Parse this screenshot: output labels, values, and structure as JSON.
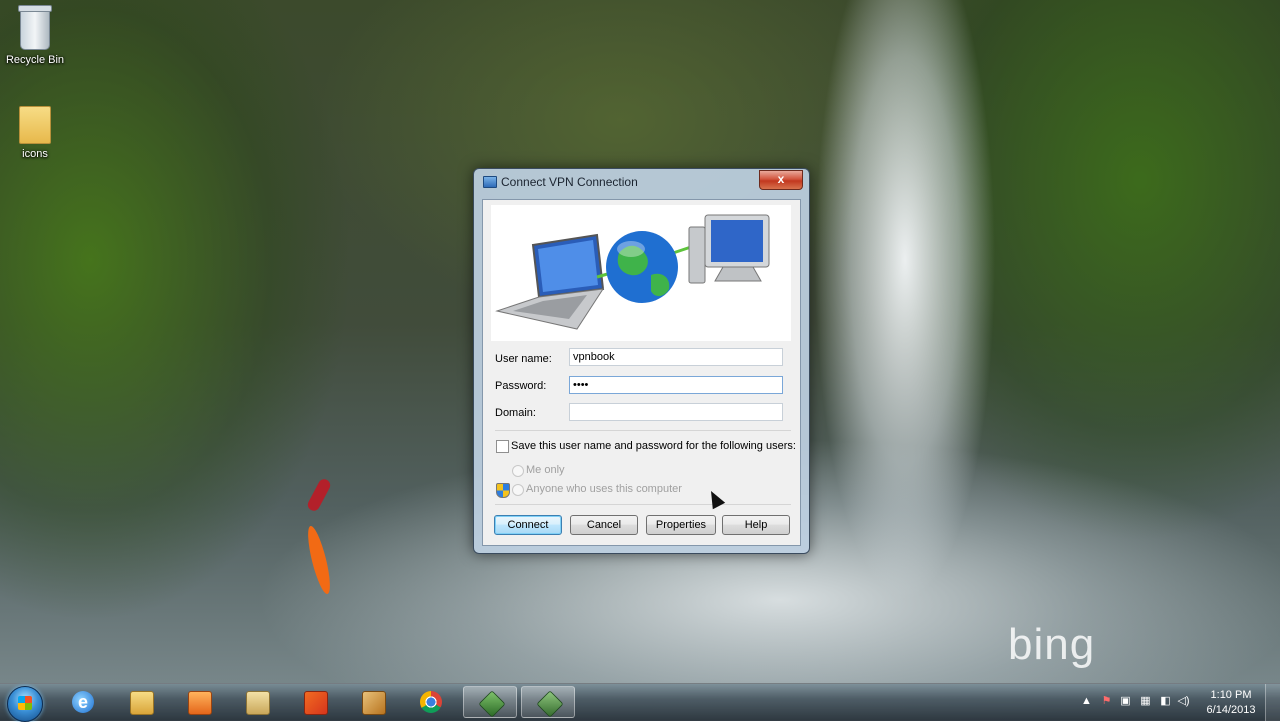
{
  "desktop": {
    "icons": [
      {
        "label": "Recycle Bin",
        "icon": "recycle-bin-icon"
      },
      {
        "label": "icons",
        "icon": "folder-icon"
      }
    ],
    "wallpaper_brand": "bing"
  },
  "dialog": {
    "title": "Connect VPN Connection",
    "close_label": "x",
    "username_label": "User name:",
    "username_value": "vpnbook",
    "password_label": "Password:",
    "password_value": "••••",
    "domain_label": "Domain:",
    "domain_value": "",
    "save_checkbox_label": "Save this user name and password for the following users:",
    "save_checked": false,
    "me_only_label": "Me only",
    "anyone_label": "Anyone who uses this computer",
    "buttons": {
      "connect": "Connect",
      "cancel": "Cancel",
      "properties": "Properties",
      "help": "Help"
    }
  },
  "taskbar": {
    "pinned": [
      {
        "name": "internet-explorer",
        "icon": "ie-icon"
      },
      {
        "name": "windows-explorer",
        "icon": "folder-icon"
      },
      {
        "name": "media-player",
        "icon": "media-player-icon"
      },
      {
        "name": "files",
        "icon": "files-icon"
      },
      {
        "name": "office",
        "icon": "office-icon"
      },
      {
        "name": "tool",
        "icon": "tool-icon"
      },
      {
        "name": "chrome",
        "icon": "chrome-icon"
      },
      {
        "name": "network-connections",
        "icon": "network-icon",
        "active": true
      },
      {
        "name": "vpn-connection",
        "icon": "vpn-icon",
        "active": true
      }
    ],
    "clock_time": "1:10 PM",
    "clock_date": "6/14/2013"
  },
  "colors": {
    "dialog_frame": "#bed0e2",
    "default_button": "#a7d9f5",
    "close_button": "#c2381f"
  }
}
